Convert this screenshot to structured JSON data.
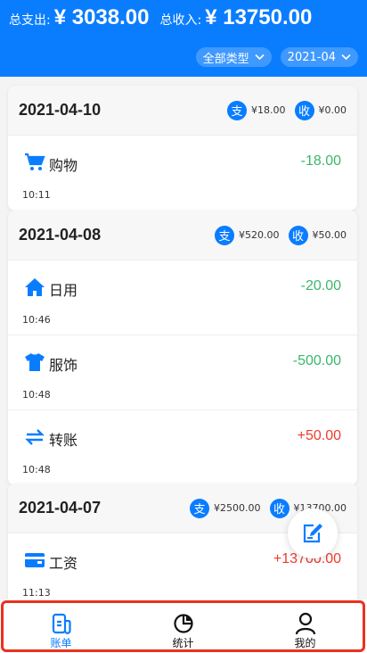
{
  "header": {
    "expense_label": "总支出:",
    "expense_value": "¥ 3038.00",
    "income_label": "总收入:",
    "income_value": "¥ 13750.00",
    "type_filter": "全部类型",
    "month_filter": "2021-04"
  },
  "colors": {
    "brand": "#0a7dff",
    "expense": "#3bb76c",
    "income": "#f03a2c",
    "highlight": "#e8321e"
  },
  "badges": {
    "expense": "支",
    "income": "收"
  },
  "days": [
    {
      "date": "2021-04-10",
      "expense": "¥18.00",
      "income": "¥0.00",
      "items": [
        {
          "icon": "cart-icon",
          "label": "购物",
          "amount": "-18.00",
          "time": "10:11",
          "type": "expense"
        }
      ]
    },
    {
      "date": "2021-04-08",
      "expense": "¥520.00",
      "income": "¥50.00",
      "items": [
        {
          "icon": "home-icon",
          "label": "日用",
          "amount": "-20.00",
          "time": "10:46",
          "type": "expense"
        },
        {
          "icon": "shirt-icon",
          "label": "服饰",
          "amount": "-500.00",
          "time": "10:48",
          "type": "expense"
        },
        {
          "icon": "transfer-icon",
          "label": "转账",
          "amount": "+50.00",
          "time": "10:48",
          "type": "income"
        }
      ]
    },
    {
      "date": "2021-04-07",
      "expense": "¥2500.00",
      "income": "¥13700.00",
      "items": [
        {
          "icon": "wallet-icon",
          "label": "工资",
          "amount": "+13700.00",
          "time": "11:13",
          "type": "income"
        }
      ]
    }
  ],
  "tabs": [
    {
      "label": "账单",
      "icon": "bill-icon",
      "active": true
    },
    {
      "label": "统计",
      "icon": "chart-pie-icon",
      "active": false
    },
    {
      "label": "我的",
      "icon": "user-icon",
      "active": false
    }
  ]
}
